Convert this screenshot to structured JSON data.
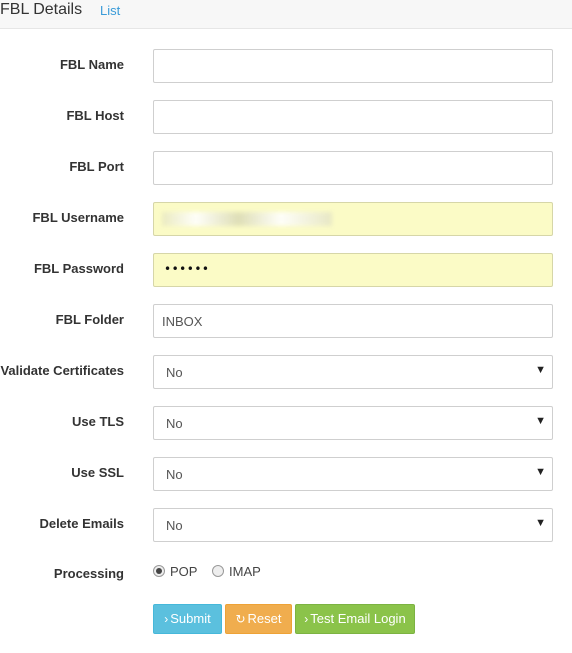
{
  "header": {
    "title": "FBL Details",
    "list_link": "List"
  },
  "fields": {
    "fbl_name": {
      "label": "FBL Name",
      "value": ""
    },
    "fbl_host": {
      "label": "FBL Host",
      "value": ""
    },
    "fbl_port": {
      "label": "FBL Port",
      "value": ""
    },
    "fbl_username": {
      "label": "FBL Username"
    },
    "fbl_password": {
      "label": "FBL Password",
      "masked": "••••••"
    },
    "fbl_folder": {
      "label": "FBL Folder",
      "value": "INBOX"
    },
    "validate_certificates": {
      "label": "Validate Certificates",
      "value": "No"
    },
    "use_tls": {
      "label": "Use TLS",
      "value": "No"
    },
    "use_ssl": {
      "label": "Use SSL",
      "value": "No"
    },
    "delete_emails": {
      "label": "Delete Emails",
      "value": "No"
    },
    "processing": {
      "label": "Processing",
      "options": [
        "POP",
        "IMAP"
      ],
      "selected": "POP"
    }
  },
  "buttons": {
    "submit": "Submit",
    "reset": "Reset",
    "test": "Test Email Login"
  },
  "icons": {
    "select_arrow": "caret-down-icon",
    "submit": "chevron-right-icon",
    "reset": "refresh-icon",
    "test": "chevron-right-icon"
  },
  "colors": {
    "link": "#3a9bd8",
    "autofill": "#fbfbc6",
    "submit": "#5bc0de",
    "reset": "#f0ad4e",
    "test": "#8bc34a"
  }
}
